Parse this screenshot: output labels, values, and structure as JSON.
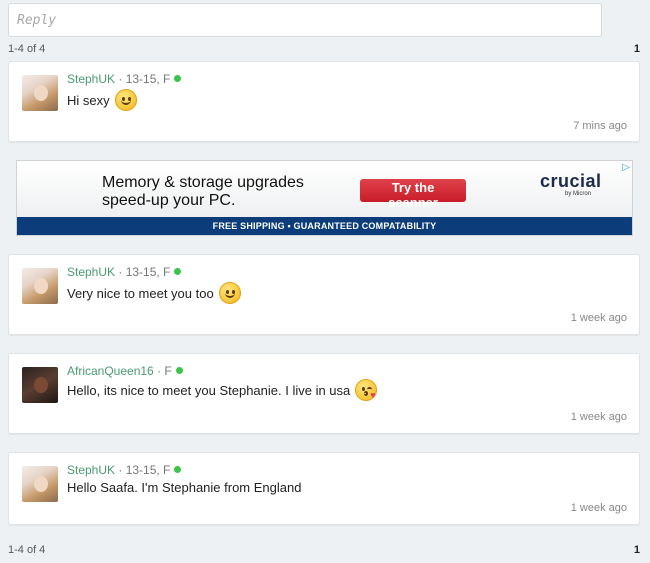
{
  "reply": {
    "placeholder": "Reply"
  },
  "pager_top": {
    "range": "1-4 of 4",
    "page": "1"
  },
  "pager_bottom": {
    "range": "1-4 of 4",
    "page": "1"
  },
  "messages": [
    {
      "user": "StephUK",
      "info": " · 13-15, F",
      "text": "Hi sexy",
      "time": "7 mins ago",
      "emoji": "smile-emoji"
    },
    {
      "user": "StephUK",
      "info": " · 13-15, F",
      "text": "Very nice to meet you too",
      "time": "1 week ago",
      "emoji": "smile-emoji"
    },
    {
      "user": "AfricanQueen16",
      "info": " · F",
      "text": "Hello, its nice to meet you Stephanie. I live in usa",
      "time": "1 week ago",
      "emoji": "wink-kiss-emoji"
    },
    {
      "user": "StephUK",
      "info": " · 13-15, F",
      "text": "Hello Saafa. I'm Stephanie from England",
      "time": "1 week ago"
    }
  ],
  "ad": {
    "headline_line1": "Memory & storage upgrades",
    "headline_line2": "speed-up your PC.",
    "cta": "Try the scanner",
    "brand": "crucial",
    "brand_sub": "by Micron",
    "bar": "FREE SHIPPING • GUARANTEED COMPATABILITY",
    "adchoices": "▷"
  },
  "colors": {
    "online": "#3cc44a",
    "username": "#4a9a6f",
    "ad_bar": "#0c3d7a",
    "cta": "#d0232e"
  }
}
